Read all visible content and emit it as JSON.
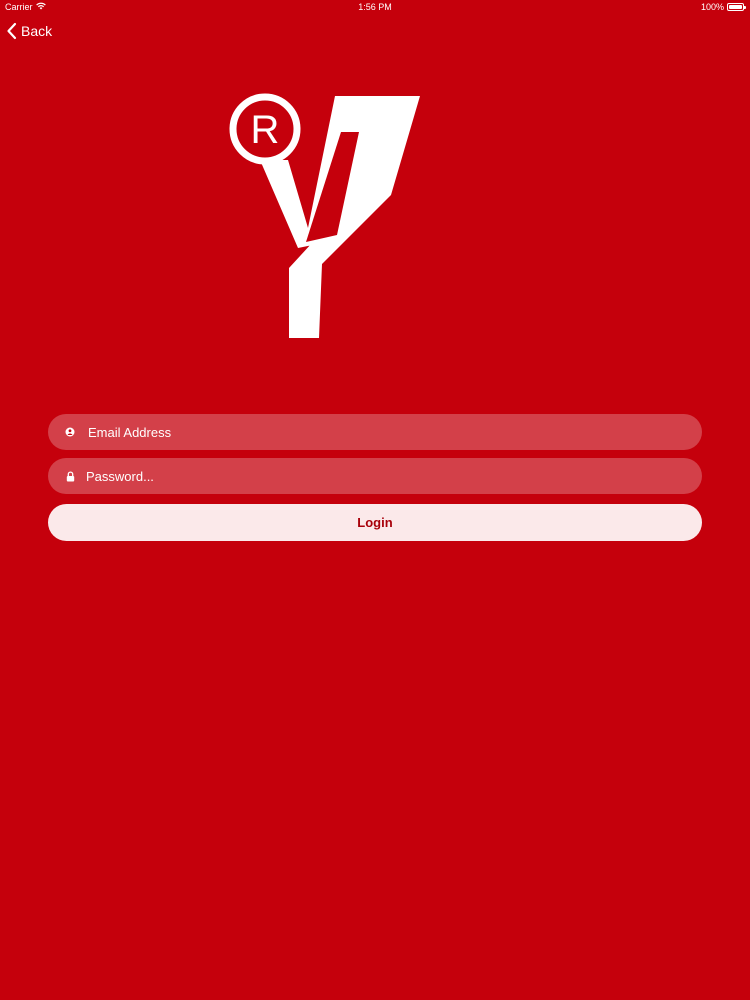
{
  "status_bar": {
    "carrier": "Carrier",
    "time": "1:56 PM",
    "battery": "100%"
  },
  "nav": {
    "back_label": "Back"
  },
  "logo": {
    "name": "brand-logo-y"
  },
  "form": {
    "email_placeholder": "Email Address",
    "password_placeholder": "Password...",
    "login_label": "Login"
  },
  "colors": {
    "background": "#c5000c",
    "button_bg": "#fbe9ea",
    "button_text": "#a8000a"
  }
}
